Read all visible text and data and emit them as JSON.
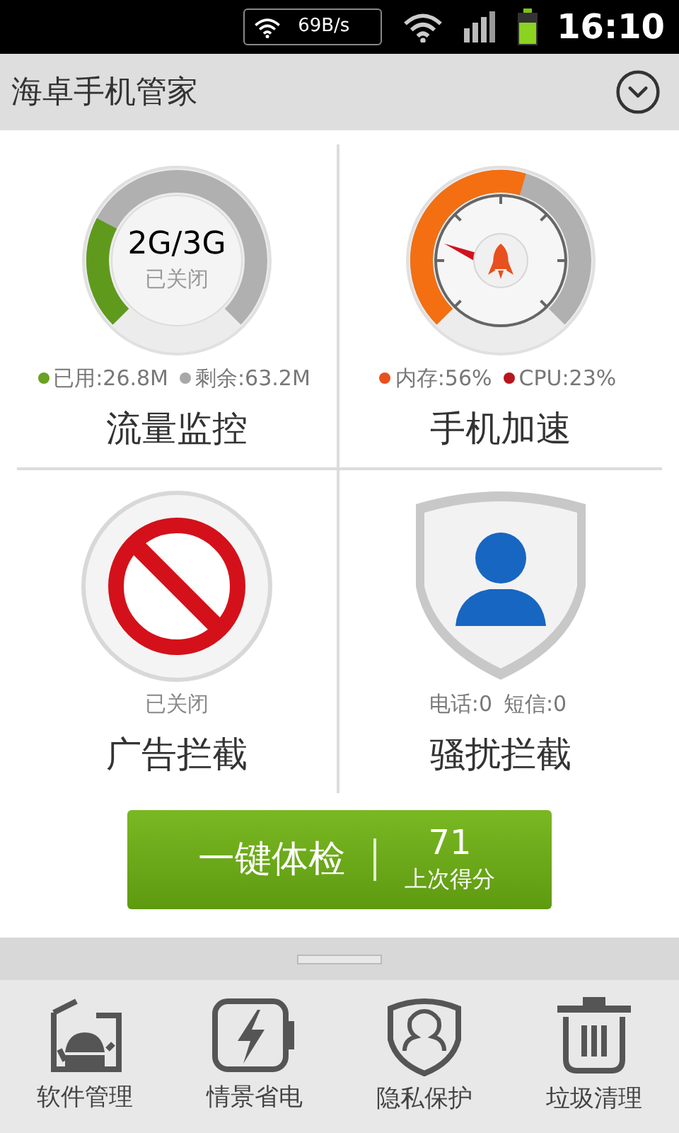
{
  "status_bar": {
    "network_speed": "69B/s",
    "time": "16:10"
  },
  "header": {
    "title": "海卓手机管家"
  },
  "tiles": [
    {
      "kind": "traffic",
      "gauge_label": "2G/3G",
      "status": "已关闭",
      "stats": [
        {
          "label": "已用:26.8M",
          "color": "#6aa121"
        },
        {
          "label": "剩余:63.2M",
          "color": "#a8a8a8"
        }
      ],
      "title": "流量监控"
    },
    {
      "kind": "speed",
      "stats": [
        {
          "label": "内存:56%",
          "color": "#e8501e"
        },
        {
          "label": "CPU:23%",
          "color": "#b8141e"
        }
      ],
      "title": "手机加速"
    },
    {
      "kind": "ad_block",
      "status": "已关闭",
      "title": "广告拦截"
    },
    {
      "kind": "harass",
      "stats": [
        {
          "label": "电话:0"
        },
        {
          "label": "短信:0"
        }
      ],
      "title": "骚扰拦截"
    }
  ],
  "checkup_button": {
    "label": "一键体检",
    "score": "71",
    "score_label": "上次得分"
  },
  "bottom_nav": [
    {
      "kind": "software",
      "label": "软件管理"
    },
    {
      "kind": "power",
      "label": "情景省电"
    },
    {
      "kind": "privacy",
      "label": "隐私保护"
    },
    {
      "kind": "cleanup",
      "label": "垃圾清理"
    }
  ]
}
